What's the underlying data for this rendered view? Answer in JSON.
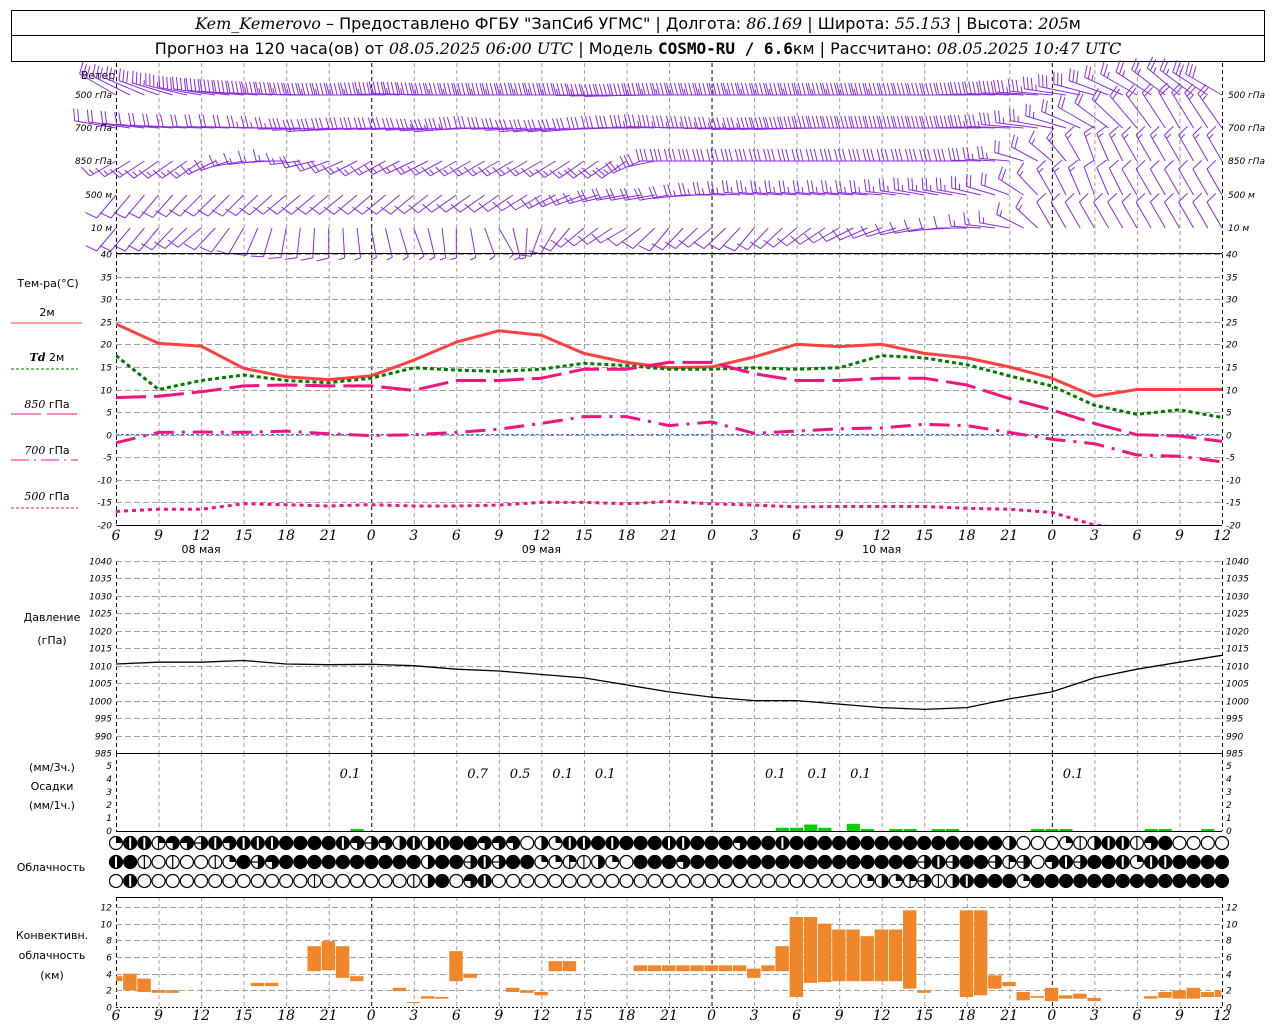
{
  "header": {
    "station": "Kem_Kemerovo",
    "provider": "– Предоставлено ФГБУ \"ЗапСиб УГМС\"",
    "lon_label": "Долгота:",
    "lon": "86.169",
    "lat_label": "Широта:",
    "lat": "55.153",
    "alt_label": "Высота:",
    "alt": "205",
    "alt_unit": "м",
    "forecast_label": "Прогноз на 120 часа(ов) от",
    "forecast_time": "08.05.2025 06:00 UTC",
    "model_label": "Модель",
    "model": "COSMO-RU / 6.6",
    "model_unit": "км",
    "calc_label": "Рассчитано:",
    "calc_time": "08.05.2025 10:47 UTC"
  },
  "colors": {
    "wind": "#8a2be2",
    "t2m": "#ff4040",
    "td2m": "#007a00",
    "upper": "#f0147c",
    "zero_line": "#3355ff",
    "precip": "#00d000",
    "convective": "#f0862a",
    "grid": "#a0a0a0"
  },
  "wind": {
    "title": "Ветер",
    "levels": [
      {
        "label": "500 гПа",
        "dir": [
          300,
          290,
          280,
          275,
          272,
          270,
          270,
          272,
          270,
          270,
          270,
          270,
          268,
          270,
          270,
          270,
          270,
          270,
          270,
          270,
          270,
          272,
          275,
          285,
          300,
          310,
          300
        ],
        "speed": [
          15,
          15,
          20,
          20,
          22,
          22,
          22,
          22,
          22,
          22,
          22,
          22,
          20,
          22,
          22,
          22,
          22,
          22,
          22,
          20,
          20,
          20,
          18,
          15,
          12,
          12,
          15
        ]
      },
      {
        "label": "700 гПа",
        "dir": [
          280,
          275,
          272,
          272,
          270,
          265,
          268,
          268,
          265,
          270,
          265,
          265,
          270,
          272,
          270,
          268,
          268,
          270,
          270,
          270,
          270,
          272,
          280,
          300,
          320,
          330,
          325
        ],
        "speed": [
          10,
          10,
          10,
          10,
          12,
          15,
          15,
          15,
          17,
          15,
          15,
          15,
          15,
          17,
          17,
          17,
          20,
          20,
          20,
          20,
          20,
          17,
          12,
          10,
          10,
          10,
          12
        ]
      },
      {
        "label": "850 гПа",
        "dir": [
          240,
          235,
          235,
          260,
          270,
          250,
          240,
          245,
          240,
          240,
          240,
          235,
          235,
          270,
          270,
          270,
          270,
          270,
          270,
          270,
          270,
          275,
          310,
          340,
          330,
          330,
          330
        ],
        "speed": [
          8,
          8,
          8,
          8,
          8,
          10,
          8,
          8,
          8,
          8,
          8,
          8,
          12,
          15,
          15,
          15,
          15,
          15,
          15,
          15,
          15,
          12,
          8,
          8,
          8,
          8,
          8
        ]
      },
      {
        "label": "500  м",
        "dir": [
          220,
          220,
          225,
          225,
          230,
          230,
          230,
          230,
          235,
          235,
          240,
          250,
          260,
          260,
          270,
          275,
          275,
          275,
          275,
          280,
          280,
          290,
          330,
          340,
          330,
          330,
          330
        ],
        "speed": [
          5,
          5,
          5,
          5,
          6,
          6,
          6,
          6,
          6,
          6,
          6,
          8,
          10,
          10,
          12,
          12,
          12,
          12,
          12,
          12,
          12,
          10,
          8,
          6,
          6,
          6,
          6
        ]
      },
      {
        "label": "10   м",
        "dir": [
          220,
          220,
          230,
          210,
          190,
          180,
          170,
          160,
          180,
          150,
          200,
          230,
          240,
          220,
          230,
          220,
          230,
          240,
          250,
          260,
          270,
          280,
          330,
          330,
          330,
          330,
          330
        ],
        "speed": [
          5,
          5,
          5,
          5,
          4,
          4,
          3,
          3,
          3,
          3,
          4,
          4,
          4,
          5,
          5,
          5,
          5,
          5,
          5,
          6,
          6,
          7,
          6,
          5,
          5,
          5,
          5
        ]
      }
    ]
  },
  "time_axis": {
    "tick_labels": [
      "6",
      "9",
      "12",
      "15",
      "18",
      "21",
      "0",
      "3",
      "6",
      "9",
      "12",
      "15",
      "18",
      "21",
      "0",
      "3",
      "6",
      "9",
      "12",
      "15",
      "18",
      "21",
      "0",
      "3",
      "6",
      "9",
      "12"
    ],
    "date_labels": [
      "08 мая",
      "09 мая",
      "10 мая"
    ]
  },
  "legend": {
    "temp_title": "Тем-ра(°C)",
    "t2m": "2м",
    "td_prefix": "Td",
    "td_suffix": "2м",
    "t850_num": "850",
    "t700_num": "700",
    "t500_num": "500",
    "hpa": "гПа",
    "pressure_title": "Давление",
    "pressure_unit": "(гПа)",
    "precip_3h": "(мм/3ч.)",
    "precip_title": "Осадки",
    "precip_1h": "(мм/1ч.)",
    "cloud_title": "Облачность",
    "conv_title1": "Конвективн.",
    "conv_title2": "облачность",
    "conv_unit": "(км)"
  },
  "chart_data": [
    {
      "type": "line",
      "title": "Тем-ра(°C)",
      "x": [
        "6",
        "9",
        "12",
        "15",
        "18",
        "21",
        "0",
        "3",
        "6",
        "9",
        "12",
        "15",
        "18",
        "21",
        "0",
        "3",
        "6",
        "9",
        "12",
        "15",
        "18",
        "21",
        "0",
        "3",
        "6",
        "9",
        "12"
      ],
      "ylim": [
        -20,
        40
      ],
      "yticks": [
        40,
        35,
        30,
        25,
        20,
        15,
        10,
        5,
        0,
        -5,
        -10,
        -15,
        -20
      ],
      "grid": true,
      "series": [
        {
          "name": "2м",
          "values": [
            24.5,
            20.2,
            19.6,
            14.7,
            12.8,
            12.2,
            13,
            16.5,
            20.5,
            23,
            22,
            18,
            16,
            14.8,
            15,
            17.2,
            20,
            19.5,
            20,
            18,
            17,
            15,
            12.5,
            8.5,
            10,
            10,
            10
          ]
        },
        {
          "name": "Td 2м",
          "values": [
            17.5,
            10,
            12,
            13.2,
            12,
            11.5,
            12.5,
            14.8,
            14.3,
            14,
            14.5,
            15.8,
            15.3,
            14.5,
            14.5,
            14.8,
            14.5,
            14.8,
            17.5,
            17,
            15.5,
            13,
            10.8,
            6.5,
            4.5,
            5.5,
            3.8
          ]
        },
        {
          "name": "850 гПа",
          "values": [
            8.2,
            8.5,
            9.5,
            10.8,
            11,
            10.8,
            10.8,
            9.8,
            12,
            12,
            12.5,
            14.5,
            14.5,
            16,
            16,
            13.5,
            12,
            12,
            12.5,
            12.5,
            11,
            8,
            5.5,
            2.5,
            0,
            -0.3,
            -1.5
          ]
        },
        {
          "name": "700 гПа",
          "values": [
            -1.8,
            0.5,
            0.6,
            0.5,
            0.8,
            0.2,
            -0.2,
            0,
            0.5,
            1.2,
            2.5,
            4,
            4,
            2,
            2.8,
            0.3,
            0.8,
            1.3,
            1.5,
            2.3,
            2,
            0.5,
            -1,
            -2,
            -4.5,
            -4.8,
            -6
          ]
        },
        {
          "name": "500 гПа",
          "values": [
            -17,
            -16.5,
            -16.5,
            -15.3,
            -15.5,
            -15.8,
            -15.5,
            -15.8,
            -15.8,
            -15.6,
            -15,
            -15,
            -15.3,
            -14.8,
            -15.3,
            -15.6,
            -16,
            -15.9,
            -15.9,
            -15.9,
            -16.3,
            -16.5,
            -17.2,
            -20,
            -21,
            -20.5,
            -21
          ]
        }
      ]
    },
    {
      "type": "line",
      "title": "Давление (гПа)",
      "x": [
        "6",
        "9",
        "12",
        "15",
        "18",
        "21",
        "0",
        "3",
        "6",
        "9",
        "12",
        "15",
        "18",
        "21",
        "0",
        "3",
        "6",
        "9",
        "12",
        "15",
        "18",
        "21",
        "0",
        "3",
        "6",
        "9",
        "12"
      ],
      "ylim": [
        985,
        1040
      ],
      "yticks": [
        1040,
        1035,
        1030,
        1025,
        1020,
        1015,
        1010,
        1005,
        1000,
        995,
        990,
        985
      ],
      "grid": true,
      "series": [
        {
          "values": [
            1010.5,
            1011,
            1011,
            1011.5,
            1010.5,
            1010.3,
            1010.4,
            1010,
            1009,
            1008.5,
            1007.5,
            1006.5,
            1004.5,
            1002.5,
            1001,
            1000,
            1000,
            999,
            998,
            997.5,
            998,
            1000.5,
            1002.5,
            1006.5,
            1009,
            1011,
            1013
          ]
        }
      ]
    },
    {
      "type": "bar",
      "title": "Осадки",
      "ylim": [
        0,
        5
      ],
      "yticks": [
        5,
        4,
        3,
        2,
        1,
        0
      ],
      "hourly_mm": [
        0,
        0,
        0,
        0,
        0,
        0,
        0,
        0,
        0,
        0,
        0,
        0,
        0,
        0,
        0,
        0,
        0,
        0.08,
        0,
        0,
        0,
        0,
        0,
        0,
        0,
        0,
        0,
        0,
        0,
        0,
        0,
        0,
        0,
        0,
        0,
        0,
        0,
        0,
        0,
        0,
        0,
        0,
        0,
        0,
        0,
        0,
        0,
        0.25,
        0.25,
        0.5,
        0.25,
        0,
        0.55,
        0.15,
        0,
        0.08,
        0.08,
        0,
        0.15,
        0.08,
        0,
        0,
        0,
        0,
        0,
        0.08,
        0.08,
        0.08,
        0,
        0,
        0,
        0,
        0,
        0.08,
        0.15,
        0,
        0,
        0.15,
        0
      ],
      "three_hour_labels": [
        {
          "interval": "08.05 21–00",
          "value": "0.1"
        },
        {
          "interval": "09.05 03–06",
          "value": "0.1"
        },
        {
          "interval": "09.05 06–09",
          "value": "0.7"
        },
        {
          "interval": "09.05 09–12",
          "value": "0.5"
        },
        {
          "interval": "09.05 12–15",
          "value": "0.1"
        },
        {
          "interval": "09.05 15–18",
          "value": "0.1"
        },
        {
          "interval": "10.05 00–03",
          "value": "0.1"
        },
        {
          "interval": "10.05 06–09",
          "value": "0.1"
        },
        {
          "interval": "10.05 09–12",
          "value": "0.1"
        }
      ]
    },
    {
      "type": "table",
      "title": "Облачность",
      "rows_octas": [
        "2773665767778888765647478866604277878887788868878888888888888884000214771680000 1",
        "7810100128568888888888488575882231420888688888888888888885758853506758872778888832",
        "0700000000000010000001480670000000000000000000000000024235147888288888888888888"
      ]
    },
    {
      "type": "bar",
      "title": "Конвективн. облачность (км)",
      "ylim": [
        0,
        13
      ],
      "yticks": [
        12,
        10,
        8,
        6,
        4,
        2,
        0
      ],
      "hourly_base_top_km": [
        [
          3.1,
          3.7
        ],
        [
          2.0,
          4.0
        ],
        [
          1.8,
          3.4
        ],
        [
          1.7,
          2.0
        ],
        [
          1.7,
          2.0
        ],
        null,
        null,
        null,
        null,
        null,
        [
          2.5,
          2.9
        ],
        [
          2.5,
          2.9
        ],
        null,
        null,
        [
          4.3,
          7.3
        ],
        [
          4.4,
          7.9
        ],
        [
          3.5,
          7.3
        ],
        [
          3.1,
          3.7
        ],
        null,
        null,
        [
          1.9,
          2.3
        ],
        [
          0.5,
          0.6
        ],
        [
          1.0,
          1.3
        ],
        [
          1.0,
          1.2
        ],
        [
          3.1,
          6.7
        ],
        [
          3.5,
          4.0
        ],
        null,
        null,
        [
          1.8,
          2.3
        ],
        [
          1.7,
          2.0
        ],
        [
          1.4,
          1.8
        ],
        [
          4.3,
          5.5
        ],
        [
          4.3,
          5.5
        ],
        null,
        null,
        null,
        null,
        [
          4.3,
          5.0
        ],
        [
          4.3,
          5.0
        ],
        [
          4.3,
          5.0
        ],
        [
          4.3,
          5.0
        ],
        [
          4.3,
          5.0
        ],
        [
          4.3,
          5.0
        ],
        [
          4.3,
          5.0
        ],
        [
          4.3,
          5.0
        ],
        [
          3.5,
          4.6
        ],
        [
          4.3,
          5.0
        ],
        [
          4.3,
          7.3
        ],
        [
          1.2,
          10.8
        ],
        [
          2.9,
          10.8
        ],
        [
          3.0,
          10.0
        ],
        [
          3.1,
          9.3
        ],
        [
          3.1,
          9.3
        ],
        [
          3.1,
          8.5
        ],
        [
          3.1,
          9.3
        ],
        [
          3.1,
          9.3
        ],
        [
          2.2,
          11.6
        ],
        [
          1.7,
          2.0
        ],
        null,
        null,
        [
          1.2,
          11.6
        ],
        [
          1.4,
          11.6
        ],
        [
          2.2,
          3.8
        ],
        [
          2.5,
          3.0
        ],
        [
          0.8,
          1.8
        ],
        [
          1.1,
          1.3
        ],
        [
          0.7,
          2.3
        ],
        [
          1.0,
          1.4
        ],
        [
          1.0,
          1.6
        ],
        [
          0.7,
          1.1
        ],
        null,
        null,
        null,
        [
          1.0,
          1.3
        ],
        [
          1.1,
          1.8
        ],
        [
          1.0,
          2.0
        ],
        [
          1.0,
          2.3
        ],
        [
          1.2,
          1.8
        ],
        [
          1.2,
          2.0
        ]
      ]
    }
  ]
}
